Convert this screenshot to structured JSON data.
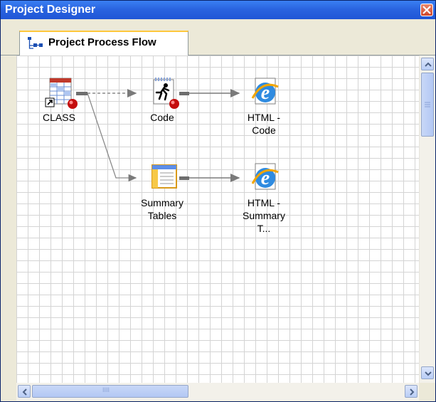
{
  "window": {
    "title": "Project Designer"
  },
  "tab": {
    "label": "Project Process Flow"
  },
  "nodes": {
    "class": {
      "label": "CLASS",
      "icon": "data-table-icon"
    },
    "code": {
      "label": "Code",
      "icon": "code-runner-icon"
    },
    "html_code": {
      "label": "HTML -\nCode",
      "icon": "internet-explorer-icon"
    },
    "summary_tables": {
      "label": "Summary\nTables",
      "icon": "summary-tables-icon"
    },
    "html_summary": {
      "label": "HTML -\nSummary T...",
      "icon": "internet-explorer-icon"
    }
  },
  "scrollbars": {
    "hgrip": "IIII"
  },
  "colors": {
    "titlebar": "#2a64e0",
    "tab_accent": "#ffc83c",
    "grid": "#d4d4d4",
    "arrow": "#6e6e6e"
  }
}
